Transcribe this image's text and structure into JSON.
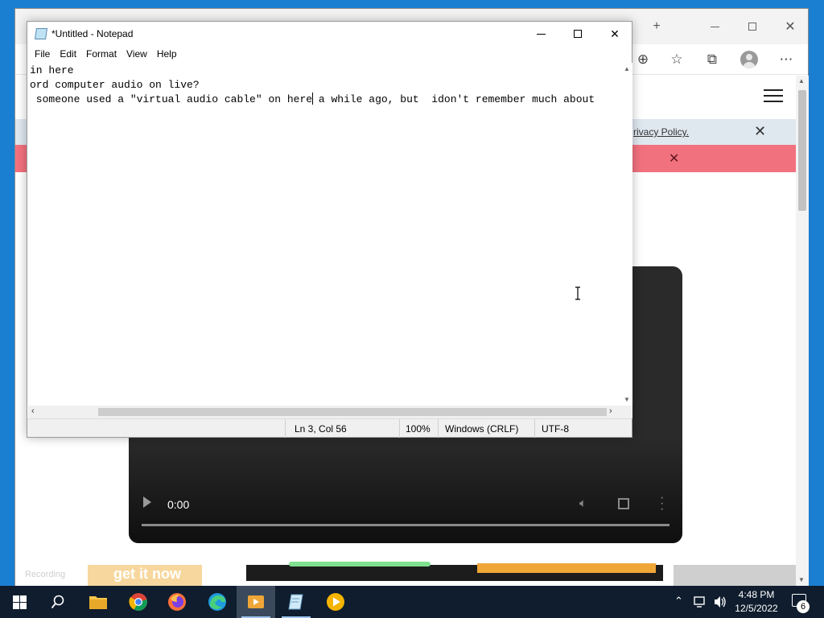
{
  "edge": {
    "hamburger_icon": "hamburger-menu-icon",
    "privacy_text": "rivacy Policy.",
    "video": {
      "time": "0:00",
      "progress": 0
    },
    "ad_strip": {
      "recording_text": "Recording",
      "get_it_now": "get it now"
    }
  },
  "notepad": {
    "title": "*Untitled - Notepad",
    "menu": [
      "File",
      "Edit",
      "Format",
      "View",
      "Help"
    ],
    "lines": [
      "in here",
      "ord computer audio on live?",
      " someone used a \"virtual audio cable\" on here",
      " a while ago, but  idon't remember much about"
    ],
    "status": {
      "position": "Ln 3, Col 56",
      "zoom": "100%",
      "line_ending": "Windows (CRLF)",
      "encoding": "UTF-8"
    }
  },
  "taskbar": {
    "apps": [
      "start",
      "search",
      "file-explorer",
      "chrome",
      "firefox",
      "edge",
      "media-app",
      "notepad",
      "player"
    ],
    "clock": {
      "time": "4:48 PM",
      "date": "12/5/2022"
    },
    "notification_count": "6"
  },
  "colors": {
    "desktop": "#1b7fd1",
    "taskbar": "#0f1d2e",
    "red_banner": "#f2717e",
    "privacy_banner": "#dfe7ef"
  }
}
